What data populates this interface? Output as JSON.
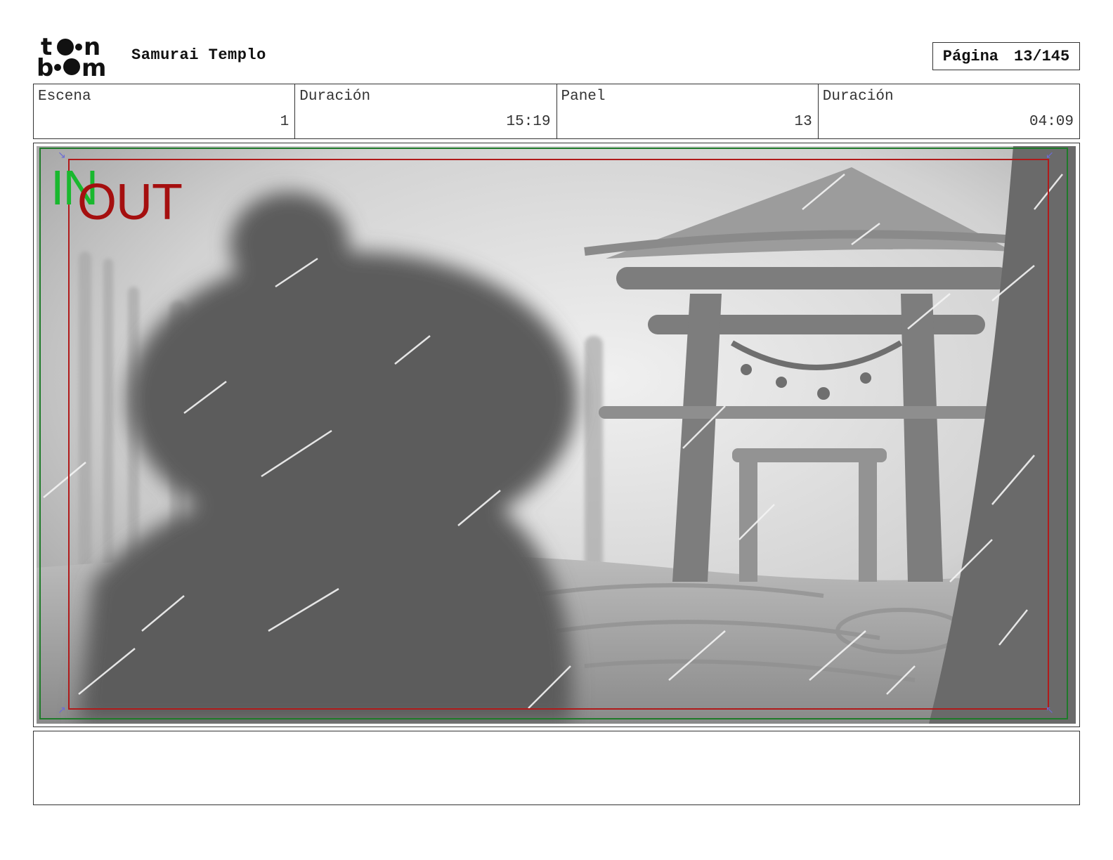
{
  "header": {
    "logo_text": "toon boom",
    "project_title": "Samurai Templo",
    "page_label": "Página",
    "page_value": "13/145"
  },
  "info": {
    "scene_label": "Escena",
    "scene_value": "1",
    "scene_duration_label": "Duración",
    "scene_duration_value": "15:19",
    "panel_label": "Panel",
    "panel_value": "13",
    "panel_duration_label": "Duración",
    "panel_duration_value": "04:09"
  },
  "panel": {
    "in_label": "IN",
    "out_label": "OUT",
    "in_color": "#1f7a2a",
    "out_color": "#b01a1a"
  },
  "notes": {
    "text": ""
  }
}
